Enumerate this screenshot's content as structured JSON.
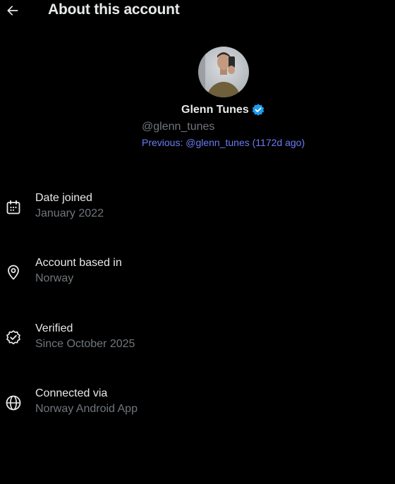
{
  "header": {
    "title": "About this account",
    "back_icon": "arrow-left-icon"
  },
  "profile": {
    "display_name": "Glenn Tunes",
    "verified": true,
    "handle": "@glenn_tunes",
    "previous_handle": "Previous: @glenn_tunes (1172d ago)"
  },
  "info_items": [
    {
      "icon": "calendar-icon",
      "label": "Date joined",
      "value": "January 2022"
    },
    {
      "icon": "location-pin-icon",
      "label": "Account based in",
      "value": "Norway"
    },
    {
      "icon": "verified-check-icon",
      "label": "Verified",
      "value": "Since October 2025"
    },
    {
      "icon": "globe-icon",
      "label": "Connected via",
      "value": "Norway Android App"
    }
  ],
  "colors": {
    "background": "#000000",
    "primary_text": "#e7e9ea",
    "secondary_text": "#71767b",
    "link": "#6a7cf5",
    "verified_blue": "#1d9bf0"
  }
}
